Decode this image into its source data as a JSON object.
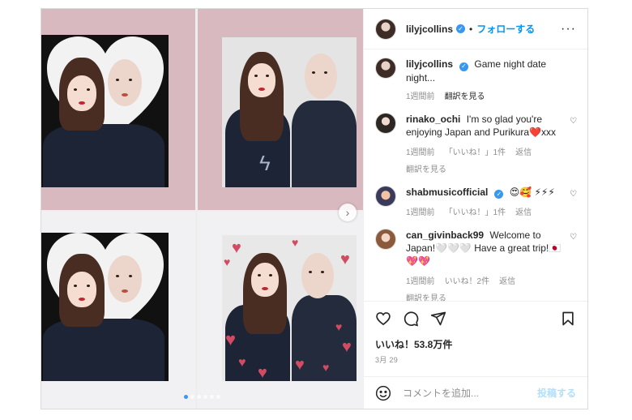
{
  "header": {
    "username": "lilyjcollins",
    "separator": "•",
    "follow_label": "フォローする",
    "more_label": "···"
  },
  "caption": {
    "username": "lilyjcollins",
    "text": "Game night date night...",
    "time": "1週間前",
    "translate": "翻訳を見る"
  },
  "comments": [
    {
      "username": "rinako_ochi",
      "text": "I'm so glad you're enjoying Japan and Purikura❤️xxx",
      "time": "1週間前",
      "likes": "「いいね！」1件",
      "reply": "返信",
      "translate": "翻訳を見る"
    },
    {
      "username": "shabmusicofficial",
      "text": "😍🥰 ⚡⚡⚡",
      "time": "1週間前",
      "likes": "「いいね！」1件",
      "reply": "返信"
    },
    {
      "username": "can_givinback99",
      "text": "Welcome to Japan!🤍🤍🤍 Have a great trip!🇯🇵💖💖",
      "time": "1週間前",
      "likes": "いいね！2件",
      "reply": "返信",
      "translate": "翻訳を見る"
    }
  ],
  "actions": {
    "likes_text": "いいね！53.8万件",
    "date": "3月 29"
  },
  "comment_box": {
    "placeholder": "コメントを追加...",
    "post_label": "投稿する"
  },
  "carousel": {
    "total": 6,
    "current": 1,
    "next_icon": "chevron-right-icon"
  },
  "colors": {
    "accent": "#0095f6",
    "post_disabled": "#b2dffc",
    "verified": "#3897f0",
    "photo_sheet_pink": "#d9b9c0"
  }
}
